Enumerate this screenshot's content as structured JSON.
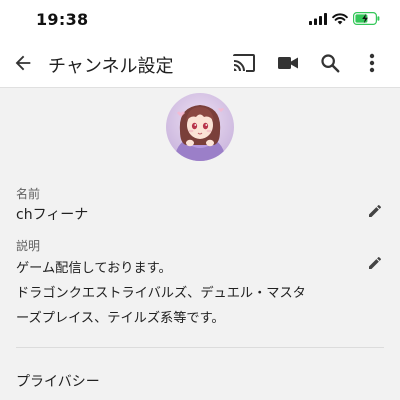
{
  "status_bar": {
    "time": "19:38",
    "icons": [
      "signal-icon",
      "wifi-icon",
      "battery-charging-icon"
    ]
  },
  "app_bar": {
    "title": "チャンネル設定",
    "icons": [
      "back-arrow-icon",
      "cast-icon",
      "video-camera-icon",
      "search-icon",
      "more-vert-icon"
    ]
  },
  "profile": {
    "name_label": "名前",
    "name_value": "chフィーナ",
    "description_label": "説明",
    "description_lines": [
      "ゲーム配信しております。",
      "ドラゴンクエストライバルズ、デュエル・マスタ",
      "ーズプレイス、テイルズ系等です。"
    ]
  },
  "sections": {
    "privacy_label": "プライバシー"
  },
  "colors": {
    "background": "#f2f2f2",
    "bar_background": "#ffffff",
    "battery_green": "#34c759",
    "avatar_bg": "#d9c6e6"
  }
}
